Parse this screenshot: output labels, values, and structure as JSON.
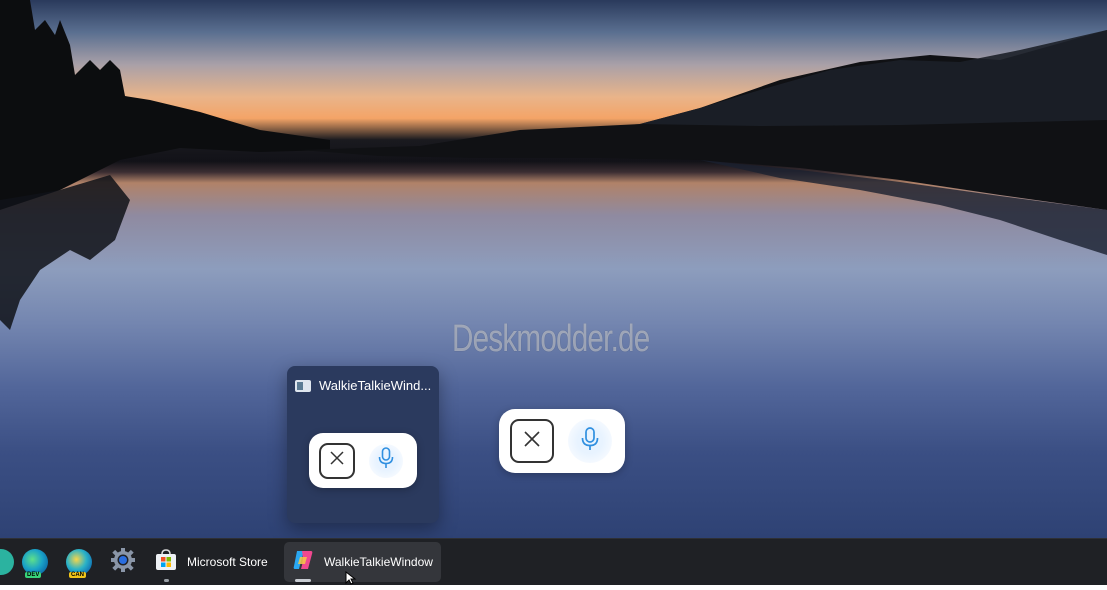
{
  "watermark": "Deskmodder.de",
  "preview": {
    "title": "WalkieTalkieWind...",
    "buttons": {
      "close_icon": "close-icon",
      "mic_icon": "microphone-icon"
    }
  },
  "overlay": {
    "buttons": {
      "close_icon": "close-icon",
      "mic_icon": "microphone-icon"
    }
  },
  "taskbar": {
    "items": [
      {
        "name": "edge-dev",
        "badge": "DEV"
      },
      {
        "name": "edge-canary",
        "badge": "CAN"
      },
      {
        "name": "settings",
        "icon": "gear-icon"
      },
      {
        "name": "microsoft-store",
        "label": "Microsoft Store"
      },
      {
        "name": "walkietalkie",
        "label": "WalkieTalkieWindow"
      }
    ]
  },
  "colors": {
    "mic_accent": "#2f8fe0",
    "taskbar_bg": "#1f2125",
    "preview_bg": "#2b3a5e"
  }
}
